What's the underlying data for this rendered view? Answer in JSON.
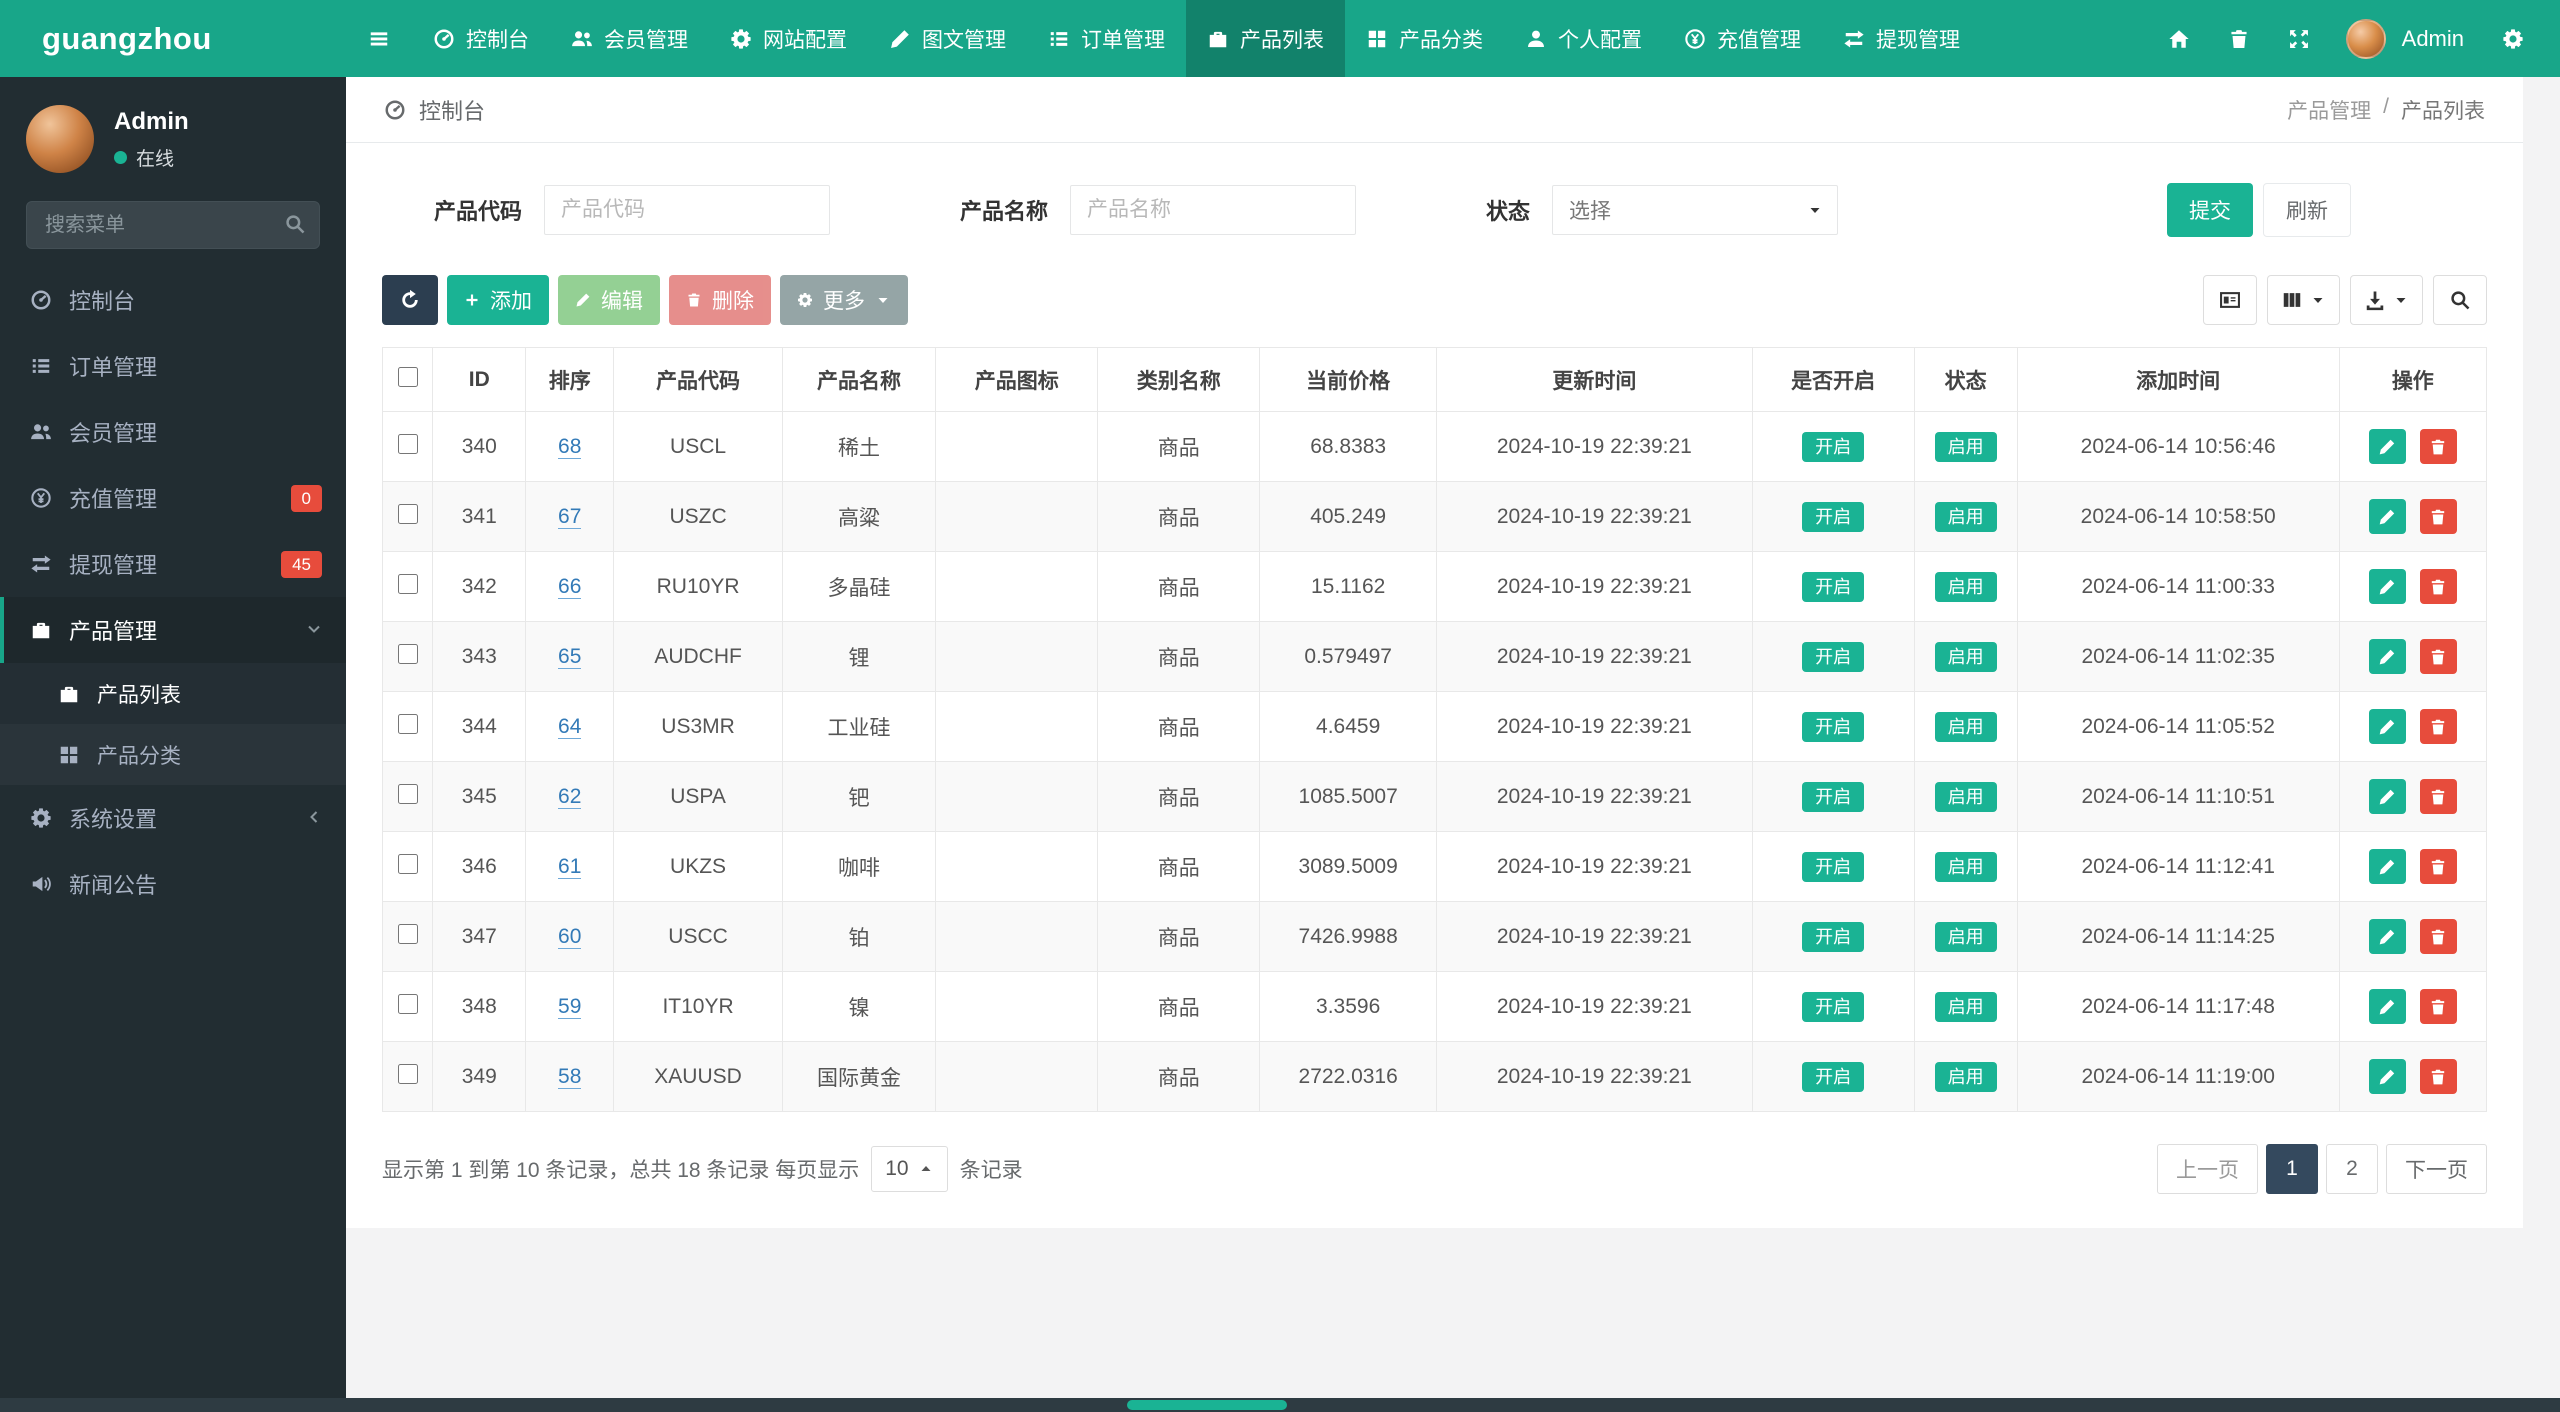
{
  "brand": "guangzhou",
  "navbar": {
    "items": [
      {
        "label": "控制台"
      },
      {
        "label": "会员管理"
      },
      {
        "label": "网站配置"
      },
      {
        "label": "图文管理"
      },
      {
        "label": "订单管理"
      },
      {
        "label": "产品列表",
        "active": true
      },
      {
        "label": "产品分类"
      },
      {
        "label": "个人配置"
      },
      {
        "label": "充值管理"
      },
      {
        "label": "提现管理"
      }
    ],
    "username": "Admin"
  },
  "sidebar": {
    "user": {
      "name": "Admin",
      "status": "在线"
    },
    "search_placeholder": "搜索菜单",
    "items": [
      {
        "label": "控制台"
      },
      {
        "label": "订单管理"
      },
      {
        "label": "会员管理"
      },
      {
        "label": "充值管理",
        "badge": "0"
      },
      {
        "label": "提现管理",
        "badge": "45"
      },
      {
        "label": "产品管理",
        "expanded": true,
        "children": [
          {
            "label": "产品列表",
            "active": true
          },
          {
            "label": "产品分类"
          }
        ]
      },
      {
        "label": "系统设置"
      },
      {
        "label": "新闻公告"
      }
    ]
  },
  "breadcrumb": {
    "left": "控制台",
    "parent": "产品管理",
    "separator": "/",
    "current": "产品列表"
  },
  "filters": {
    "code_label": "产品代码",
    "code_placeholder": "产品代码",
    "name_label": "产品名称",
    "name_placeholder": "产品名称",
    "status_label": "状态",
    "status_value": "选择",
    "submit": "提交",
    "refresh": "刷新"
  },
  "toolbar": {
    "add": "添加",
    "edit": "编辑",
    "delete": "删除",
    "more": "更多"
  },
  "table": {
    "headers": [
      "ID",
      "排序",
      "产品代码",
      "产品名称",
      "产品图标",
      "类别名称",
      "当前价格",
      "更新时间",
      "是否开启",
      "状态",
      "添加时间",
      "操作"
    ],
    "rows": [
      {
        "id": "340",
        "sort": "68",
        "code": "USCL",
        "name": "稀土",
        "icon": "",
        "category": "商品",
        "price": "68.8383",
        "updated": "2024-10-19 22:39:21",
        "enabled": "开启",
        "status": "启用",
        "added": "2024-06-14 10:56:46"
      },
      {
        "id": "341",
        "sort": "67",
        "code": "USZC",
        "name": "高粱",
        "icon": "",
        "category": "商品",
        "price": "405.249",
        "updated": "2024-10-19 22:39:21",
        "enabled": "开启",
        "status": "启用",
        "added": "2024-06-14 10:58:50"
      },
      {
        "id": "342",
        "sort": "66",
        "code": "RU10YR",
        "name": "多晶硅",
        "icon": "",
        "category": "商品",
        "price": "15.1162",
        "updated": "2024-10-19 22:39:21",
        "enabled": "开启",
        "status": "启用",
        "added": "2024-06-14 11:00:33"
      },
      {
        "id": "343",
        "sort": "65",
        "code": "AUDCHF",
        "name": "锂",
        "icon": "",
        "category": "商品",
        "price": "0.579497",
        "updated": "2024-10-19 22:39:21",
        "enabled": "开启",
        "status": "启用",
        "added": "2024-06-14 11:02:35"
      },
      {
        "id": "344",
        "sort": "64",
        "code": "US3MR",
        "name": "工业硅",
        "icon": "",
        "category": "商品",
        "price": "4.6459",
        "updated": "2024-10-19 22:39:21",
        "enabled": "开启",
        "status": "启用",
        "added": "2024-06-14 11:05:52"
      },
      {
        "id": "345",
        "sort": "62",
        "code": "USPA",
        "name": "钯",
        "icon": "",
        "category": "商品",
        "price": "1085.5007",
        "updated": "2024-10-19 22:39:21",
        "enabled": "开启",
        "status": "启用",
        "added": "2024-06-14 11:10:51"
      },
      {
        "id": "346",
        "sort": "61",
        "code": "UKZS",
        "name": "咖啡",
        "icon": "",
        "category": "商品",
        "price": "3089.5009",
        "updated": "2024-10-19 22:39:21",
        "enabled": "开启",
        "status": "启用",
        "added": "2024-06-14 11:12:41"
      },
      {
        "id": "347",
        "sort": "60",
        "code": "USCC",
        "name": "铂",
        "icon": "",
        "category": "商品",
        "price": "7426.9988",
        "updated": "2024-10-19 22:39:21",
        "enabled": "开启",
        "status": "启用",
        "added": "2024-06-14 11:14:25"
      },
      {
        "id": "348",
        "sort": "59",
        "code": "IT10YR",
        "name": "镍",
        "icon": "",
        "category": "商品",
        "price": "3.3596",
        "updated": "2024-10-19 22:39:21",
        "enabled": "开启",
        "status": "启用",
        "added": "2024-06-14 11:17:48"
      },
      {
        "id": "349",
        "sort": "58",
        "code": "XAUUSD",
        "name": "国际黄金",
        "icon": "",
        "category": "商品",
        "price": "2722.0316",
        "updated": "2024-10-19 22:39:21",
        "enabled": "开启",
        "status": "启用",
        "added": "2024-06-14 11:19:00"
      }
    ]
  },
  "footer": {
    "summary_before": "显示第 1 到第 10 条记录，总共 18 条记录 每页显示",
    "page_size": "10",
    "summary_after": "条记录",
    "prev": "上一页",
    "pages": [
      "1",
      "2"
    ],
    "next": "下一页"
  },
  "icons": {
    "menu-icon": "three bars",
    "dashboard-icon": "gauge",
    "users-icon": "two people",
    "gear-icon": "cog",
    "pencil-icon": "pencil",
    "list-icon": "list lines",
    "bag-icon": "briefcase",
    "grid-icon": "grid squares",
    "user-icon": "person",
    "coin-icon": "yen coin",
    "exchange-icon": "double arrows",
    "home-icon": "house",
    "trash-icon": "trash can",
    "expand-icon": "four arrows",
    "search-icon": "magnifier",
    "refresh-icon": "circular arrow",
    "plus-icon": "plus",
    "megaphone-icon": "announcement speaker",
    "caret-down-icon": "▾",
    "caret-up-icon": "▴",
    "chevron-down-icon": "v",
    "chevron-left-icon": "<",
    "card-view-icon": "card outline",
    "columns-icon": "three columns",
    "export-icon": "download arrow"
  }
}
